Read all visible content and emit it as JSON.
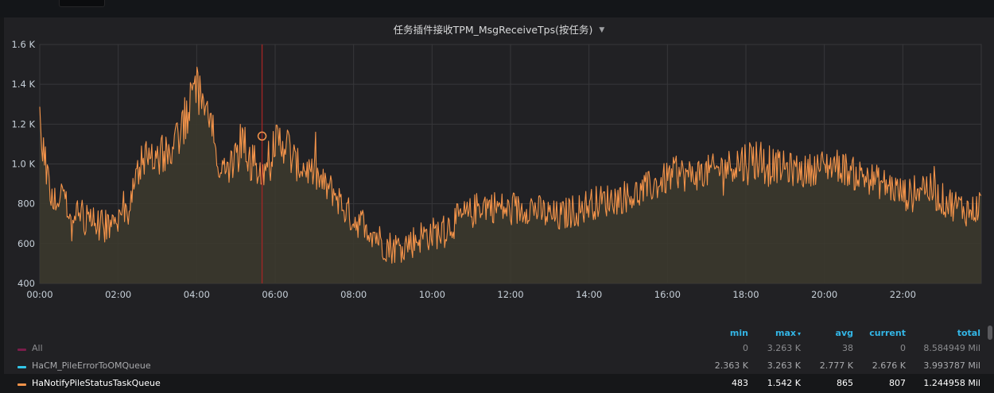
{
  "panel": {
    "title": "任务插件接收TPM_MsgReceiveTps(按任务)",
    "caret": "▼"
  },
  "colors": {
    "series": "#f5944a",
    "fill": "#3c3a2e",
    "marker": "#a32525",
    "header": "#33b5e5",
    "grid": "#37373a"
  },
  "chart_data": {
    "type": "line",
    "title": "任务插件接收TPM_MsgReceiveTps(按任务)",
    "x_ticks": [
      "00:00",
      "02:00",
      "04:00",
      "06:00",
      "08:00",
      "10:00",
      "12:00",
      "14:00",
      "16:00",
      "18:00",
      "20:00",
      "22:00"
    ],
    "y_ticks": [
      "400",
      "600",
      "800",
      "1.0 K",
      "1.2 K",
      "1.4 K",
      "1.6 K"
    ],
    "xlim_hours": [
      0,
      24
    ],
    "ylim": [
      400,
      1600
    ],
    "grid": true,
    "legend_position": "bottom",
    "marker_time": "05:40",
    "hover_value": 1140,
    "series": [
      {
        "name": "HaNotifyPileStatusTaskQueue",
        "x_hours": [
          0,
          0.25,
          0.5,
          0.75,
          1,
          1.25,
          1.5,
          1.75,
          2,
          2.25,
          2.5,
          2.75,
          3,
          3.25,
          3.5,
          3.75,
          4,
          4.25,
          4.5,
          4.75,
          5,
          5.25,
          5.5,
          5.75,
          6,
          6.25,
          6.5,
          6.75,
          7,
          7.25,
          7.5,
          7.75,
          8,
          8.25,
          8.5,
          8.75,
          9,
          9.25,
          9.5,
          9.75,
          10,
          10.25,
          10.5,
          10.75,
          11,
          11.25,
          11.5,
          11.75,
          12,
          12.25,
          12.5,
          12.75,
          13,
          13.25,
          13.5,
          13.75,
          14,
          14.25,
          14.5,
          14.75,
          15,
          15.25,
          15.5,
          15.75,
          16,
          16.25,
          16.5,
          16.75,
          17,
          17.25,
          17.5,
          17.75,
          18,
          18.25,
          18.5,
          18.75,
          19,
          19.25,
          19.5,
          19.75,
          20,
          20.25,
          20.5,
          20.75,
          21,
          21.25,
          21.5,
          21.75,
          22,
          22.25,
          22.5,
          22.75,
          23,
          23.25,
          23.5,
          23.75,
          24
        ],
        "values": [
          1200,
          860,
          830,
          770,
          740,
          720,
          690,
          680,
          700,
          760,
          1000,
          1060,
          1020,
          1040,
          1120,
          1240,
          1380,
          1300,
          1050,
          940,
          1030,
          1080,
          990,
          960,
          1100,
          1120,
          1000,
          980,
          950,
          890,
          860,
          780,
          720,
          700,
          660,
          600,
          580,
          590,
          610,
          640,
          650,
          660,
          700,
          730,
          750,
          800,
          790,
          780,
          760,
          770,
          790,
          760,
          740,
          730,
          760,
          770,
          800,
          810,
          820,
          830,
          840,
          850,
          880,
          900,
          930,
          960,
          940,
          950,
          960,
          970,
          990,
          1000,
          1010,
          1030,
          1010,
          990,
          980,
          970,
          960,
          980,
          990,
          1000,
          980,
          950,
          940,
          920,
          900,
          880,
          850,
          840,
          900,
          860,
          820,
          800,
          780,
          760,
          800
        ]
      }
    ]
  },
  "legend": {
    "headers": {
      "min": "min",
      "max": "max",
      "sort_caret": "▾",
      "avg": "avg",
      "current": "current",
      "total": "total"
    },
    "rows": [
      {
        "name": "All",
        "color": "#7a1d4a",
        "min": "0",
        "max": "3.263 K",
        "avg": "38",
        "current": "0",
        "total": "8.584949 Mil"
      },
      {
        "name": "HaCM_PileErrorToOMQueue",
        "color": "#33c6e8",
        "min": "2.363 K",
        "max": "3.263 K",
        "avg": "2.777 K",
        "current": "2.676 K",
        "total": "3.993787 Mil"
      },
      {
        "name": "HaNotifyPileStatusTaskQueue",
        "color": "#f5944a",
        "min": "483",
        "max": "1.542 K",
        "avg": "865",
        "current": "807",
        "total": "1.244958 Mil"
      }
    ]
  }
}
